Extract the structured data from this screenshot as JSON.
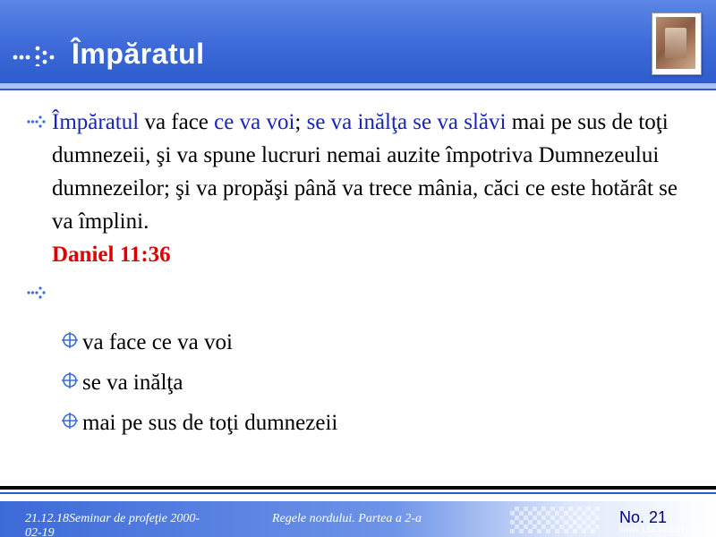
{
  "slide": {
    "title": "Împăratul"
  },
  "colors": {
    "header": "#3d6ad8",
    "highlight": "#1a24b8",
    "reference": "#e00000",
    "footer_number": "#000080"
  },
  "main_bullet": {
    "segments": [
      {
        "text": "Împăratul",
        "style": "highlight"
      },
      {
        "text": " va face ",
        "style": "normal"
      },
      {
        "text": "ce va voi",
        "style": "highlight"
      },
      {
        "text": "; ",
        "style": "normal"
      },
      {
        "text": "se va inălţa se va slăvi",
        "style": "highlight"
      },
      {
        "text": " mai pe sus de toţi dumnezeii, şi va spune lucruri nemai auzite împotriva Dumnezeului dumnezeilor; şi va propăşi până va trece mânia, căci ce este hotărât se va împlini.",
        "style": "normal"
      }
    ],
    "reference": "Daniel 11:36"
  },
  "sub_items": [
    {
      "label": "va face ce va voi"
    },
    {
      "label": "se va inălţa"
    },
    {
      "label": "mai pe sus de toţi dumnezeii"
    }
  ],
  "icons": {
    "title_decoration": "dotted-arrow-icon",
    "bullet": "arrow-bullet-icon",
    "sub_bullet": "crosshair-bullet-icon",
    "logo": "holy-bible-logo"
  },
  "footer": {
    "left": "21.12.18Seminar de profeţie 2000-02-19",
    "middle": "Regele nordului. Partea a 2-a",
    "slide_number": "No. 21",
    "url": "www.1843-chart.com"
  }
}
